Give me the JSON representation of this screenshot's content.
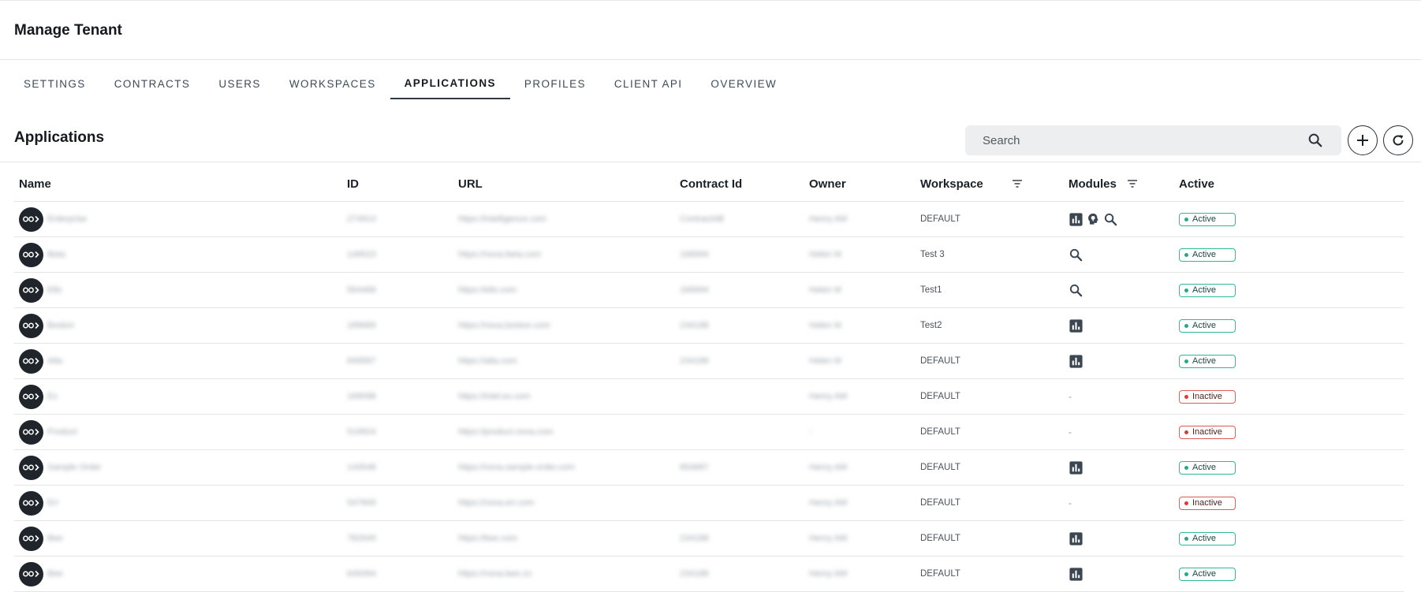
{
  "page": {
    "title": "Manage Tenant"
  },
  "tabs": [
    {
      "label": "SETTINGS",
      "active": false
    },
    {
      "label": "CONTRACTS",
      "active": false
    },
    {
      "label": "USERS",
      "active": false
    },
    {
      "label": "WORKSPACES",
      "active": false
    },
    {
      "label": "APPLICATIONS",
      "active": true
    },
    {
      "label": "PROFILES",
      "active": false
    },
    {
      "label": "CLIENT API",
      "active": false
    },
    {
      "label": "OVERVIEW",
      "active": false
    }
  ],
  "section": {
    "title": "Applications"
  },
  "search": {
    "placeholder": "Search",
    "value": ""
  },
  "icons": {
    "search": "search-icon",
    "add": "plus-icon",
    "refresh": "refresh-icon",
    "filter": "filter-icon",
    "avatar": "app-logo-icon",
    "analytics": "bar-chart-icon",
    "insights": "brain-bulb-icon",
    "search_module": "search-icon"
  },
  "colors": {
    "active_border": "#2db89b",
    "inactive_border": "#e05a57",
    "avatar_bg": "#1f252b"
  },
  "table": {
    "columns": [
      "Name",
      "ID",
      "URL",
      "Contract Id",
      "Owner",
      "Workspace",
      "Modules",
      "Active"
    ],
    "rows": [
      {
        "name": "Enterprise",
        "id": "274914",
        "url": "https://intelligence.com",
        "contract": "ContractAB",
        "owner": "Henry AM",
        "workspace": "DEFAULT",
        "modules": [
          "analytics",
          "insights",
          "search"
        ],
        "status": "Active"
      },
      {
        "name": "Beta",
        "id": "149523",
        "url": "https://nova.beta.com",
        "contract": "168994",
        "owner": "Helen M",
        "workspace": "Test 3",
        "modules": [
          "search"
        ],
        "status": "Active"
      },
      {
        "name": "Ello",
        "id": "564468",
        "url": "https://ello.com",
        "contract": "168994",
        "owner": "Helen M",
        "workspace": "Test1",
        "modules": [
          "search"
        ],
        "status": "Active"
      },
      {
        "name": "Boston",
        "id": "189689",
        "url": "https://nova.boston.com",
        "contract": "234188",
        "owner": "Helen M",
        "workspace": "Test2",
        "modules": [
          "analytics"
        ],
        "status": "Active"
      },
      {
        "name": "Atla",
        "id": "849587",
        "url": "https://atla.com",
        "contract": "234188",
        "owner": "Helen M",
        "workspace": "DEFAULT",
        "modules": [
          "analytics"
        ],
        "status": "Active"
      },
      {
        "name": "Ex",
        "id": "169098",
        "url": "https://intel.ex.com",
        "contract": "",
        "owner": "Henry AM",
        "workspace": "DEFAULT",
        "modules": [],
        "status": "Inactive"
      },
      {
        "name": "Product",
        "id": "519924",
        "url": "https://product.nova.com",
        "contract": "",
        "owner": "-",
        "workspace": "DEFAULT",
        "modules": [],
        "status": "Inactive"
      },
      {
        "name": "Sample Order",
        "id": "143548",
        "url": "https://nova.sample-order.com",
        "contract": "893687",
        "owner": "Henry AM",
        "workspace": "DEFAULT",
        "modules": [
          "analytics"
        ],
        "status": "Active"
      },
      {
        "name": "Err",
        "id": "547849",
        "url": "https://nova.err.com",
        "contract": "",
        "owner": "Henry AM",
        "workspace": "DEFAULT",
        "modules": [],
        "status": "Inactive"
      },
      {
        "name": "Bee",
        "id": "782649",
        "url": "https://bee.com",
        "contract": "234188",
        "owner": "Henry AM",
        "workspace": "DEFAULT",
        "modules": [
          "analytics"
        ],
        "status": "Active"
      },
      {
        "name": "Bee",
        "id": "649394",
        "url": "https://nova.bee.co",
        "contract": "234188",
        "owner": "Henry AM",
        "workspace": "DEFAULT",
        "modules": [
          "analytics"
        ],
        "status": "Active"
      }
    ]
  }
}
